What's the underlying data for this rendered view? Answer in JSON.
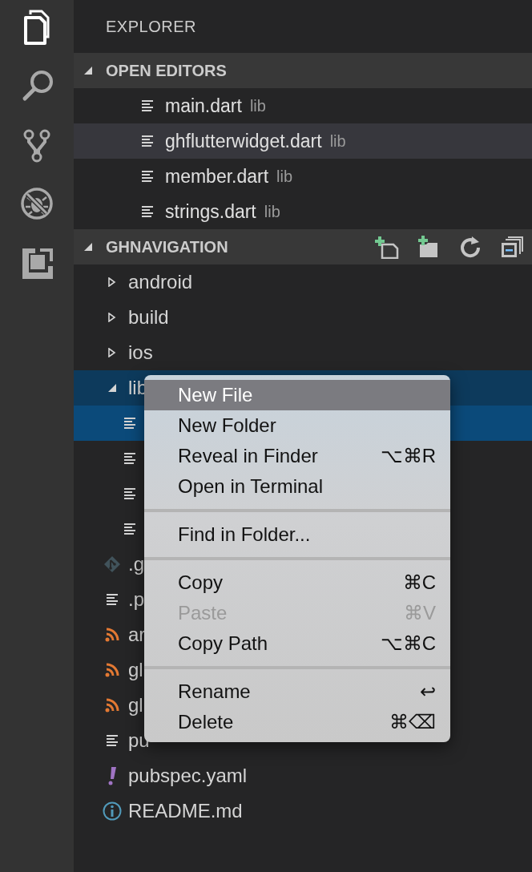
{
  "activity_bar": [
    {
      "kind": "files",
      "selected": true
    },
    {
      "kind": "search",
      "selected": false
    },
    {
      "kind": "source-control",
      "selected": false
    },
    {
      "kind": "debug",
      "selected": false
    },
    {
      "kind": "extensions",
      "selected": false
    }
  ],
  "sidebar": {
    "title": "EXPLORER",
    "open_editors": {
      "title": "OPEN EDITORS",
      "expanded": true,
      "items": [
        {
          "name": "main.dart",
          "folder": "lib",
          "selected": false
        },
        {
          "name": "ghflutterwidget.dart",
          "folder": "lib",
          "selected": true
        },
        {
          "name": "member.dart",
          "folder": "lib",
          "selected": false
        },
        {
          "name": "strings.dart",
          "folder": "lib",
          "selected": false
        }
      ]
    },
    "project": {
      "title": "GHNAVIGATION",
      "expanded": true,
      "items": [
        {
          "kind": "folder",
          "label": "android",
          "expanded": false,
          "selected": false,
          "active": false
        },
        {
          "kind": "folder",
          "label": "build",
          "expanded": false,
          "selected": false,
          "active": false
        },
        {
          "kind": "folder",
          "label": "ios",
          "expanded": false,
          "selected": false,
          "active": false
        },
        {
          "kind": "folder",
          "label": "lib",
          "expanded": true,
          "selected": false,
          "active": true,
          "children": [
            {
              "kind": "file",
              "selected": true,
              "active": false
            },
            {
              "kind": "file",
              "selected": false,
              "active": false
            },
            {
              "kind": "file",
              "selected": false,
              "active": false
            },
            {
              "kind": "file",
              "selected": false,
              "active": false
            }
          ]
        },
        {
          "kind": "git",
          "label": ".g",
          "selected": false,
          "active": false
        },
        {
          "kind": "file",
          "label": ".p",
          "selected": false,
          "active": false
        },
        {
          "kind": "rss",
          "label": "ar",
          "selected": false,
          "active": false
        },
        {
          "kind": "rss",
          "label": "gl",
          "selected": false,
          "active": false
        },
        {
          "kind": "rss",
          "label": "gl",
          "selected": false,
          "active": false
        },
        {
          "kind": "file",
          "label": "pu",
          "selected": false,
          "active": false
        },
        {
          "kind": "yaml",
          "label": "pubspec.yaml",
          "selected": false,
          "active": false
        },
        {
          "kind": "info",
          "label": "README.md",
          "selected": false,
          "active": false
        }
      ]
    }
  },
  "context_menu": {
    "items": [
      {
        "kind": "item",
        "label": "New File",
        "selected": true,
        "disabled": false
      },
      {
        "kind": "item",
        "label": "New Folder",
        "selected": false,
        "disabled": false
      },
      {
        "kind": "item",
        "label": "Reveal in Finder",
        "shortcut": "⌥⌘R",
        "selected": false,
        "disabled": false
      },
      {
        "kind": "item",
        "label": "Open in Terminal",
        "selected": false,
        "disabled": false
      },
      {
        "kind": "separator"
      },
      {
        "kind": "item",
        "label": "Find in Folder...",
        "selected": false,
        "disabled": false
      },
      {
        "kind": "separator"
      },
      {
        "kind": "item",
        "label": "Copy",
        "shortcut": "⌘C",
        "selected": false,
        "disabled": false
      },
      {
        "kind": "item",
        "label": "Paste",
        "shortcut": "⌘V",
        "selected": false,
        "disabled": true
      },
      {
        "kind": "item",
        "label": "Copy Path",
        "shortcut": "⌥⌘C",
        "selected": false,
        "disabled": false
      },
      {
        "kind": "separator"
      },
      {
        "kind": "item",
        "label": "Rename",
        "shortcut": "↩",
        "selected": false,
        "disabled": false
      },
      {
        "kind": "item",
        "label": "Delete",
        "shortcut": "⌘⌫",
        "selected": false,
        "disabled": false
      }
    ]
  }
}
